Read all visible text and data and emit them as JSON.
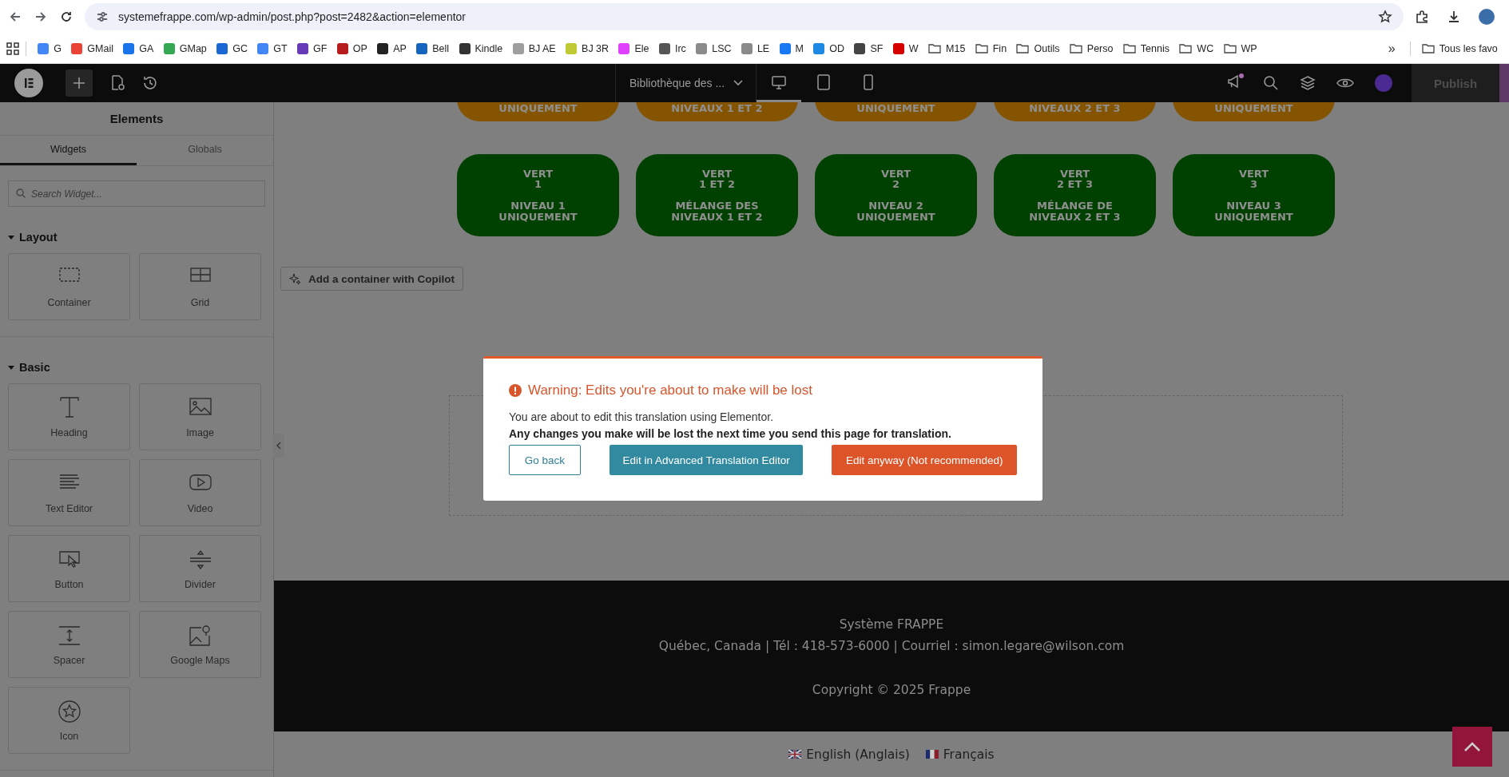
{
  "browser": {
    "address": "systemefrappe.com/wp-admin/post.php?post=2482&action=elementor",
    "bookmarks": [
      {
        "label": "G",
        "kind": "site",
        "color": "#4285f4"
      },
      {
        "label": "GMail",
        "kind": "site",
        "color": "#ea4335"
      },
      {
        "label": "GA",
        "kind": "site",
        "color": "#1a73e8"
      },
      {
        "label": "GMap",
        "kind": "site",
        "color": "#34a853"
      },
      {
        "label": "GC",
        "kind": "site",
        "color": "#1967d2"
      },
      {
        "label": "GT",
        "kind": "site",
        "color": "#4285f4"
      },
      {
        "label": "GF",
        "kind": "site",
        "color": "#673ab7"
      },
      {
        "label": "OP",
        "kind": "site",
        "color": "#b71c1c"
      },
      {
        "label": "AP",
        "kind": "site",
        "color": "#222222"
      },
      {
        "label": "Bell",
        "kind": "site",
        "color": "#1565c0"
      },
      {
        "label": "Kindle",
        "kind": "site",
        "color": "#333333"
      },
      {
        "label": "BJ AE",
        "kind": "site",
        "color": "#9e9e9e"
      },
      {
        "label": "BJ 3R",
        "kind": "site",
        "color": "#c0ca33"
      },
      {
        "label": "Ele",
        "kind": "site",
        "color": "#e040fb"
      },
      {
        "label": "Irc",
        "kind": "site",
        "color": "#555555"
      },
      {
        "label": "LSC",
        "kind": "site",
        "color": "#8a8a8a"
      },
      {
        "label": "LE",
        "kind": "site",
        "color": "#8a8a8a"
      },
      {
        "label": "M",
        "kind": "site",
        "color": "#1877f2"
      },
      {
        "label": "OD",
        "kind": "site",
        "color": "#1e88e5"
      },
      {
        "label": "SF",
        "kind": "site",
        "color": "#444444"
      },
      {
        "label": "W",
        "kind": "site",
        "color": "#d50000"
      },
      {
        "label": "M15",
        "kind": "folder"
      },
      {
        "label": "Fin",
        "kind": "folder"
      },
      {
        "label": "Outils",
        "kind": "folder"
      },
      {
        "label": "Perso",
        "kind": "folder"
      },
      {
        "label": "Tennis",
        "kind": "folder"
      },
      {
        "label": "WC",
        "kind": "folder"
      },
      {
        "label": "WP",
        "kind": "folder"
      }
    ],
    "more": "»",
    "all_bookmarks": "Tous les favo"
  },
  "editor_bar": {
    "library": "Bibliothèque des ...",
    "devices": [
      {
        "kind": "desktop",
        "selected": true
      },
      {
        "kind": "tablet",
        "selected": false
      },
      {
        "kind": "mobile",
        "selected": false
      }
    ],
    "publish": "Publish"
  },
  "panel": {
    "title": "Elements",
    "tabs": [
      {
        "label": "Widgets",
        "selected": true
      },
      {
        "label": "Globals",
        "selected": false
      }
    ],
    "search": {
      "placeholder": "Search Widget..."
    },
    "sections": [
      {
        "title": "Layout",
        "expanded": true,
        "widgets": [
          {
            "label": "Container",
            "kind": "container"
          },
          {
            "label": "Grid",
            "kind": "grid"
          }
        ]
      },
      {
        "title": "Basic",
        "expanded": true,
        "widgets": [
          {
            "label": "Heading",
            "kind": "heading"
          },
          {
            "label": "Image",
            "kind": "image"
          },
          {
            "label": "Text Editor",
            "kind": "text"
          },
          {
            "label": "Video",
            "kind": "video"
          },
          {
            "label": "Button",
            "kind": "button"
          },
          {
            "label": "Divider",
            "kind": "divider"
          },
          {
            "label": "Spacer",
            "kind": "spacer"
          },
          {
            "label": "Google Maps",
            "kind": "map"
          },
          {
            "label": "Icon",
            "kind": "icon"
          }
        ]
      }
    ]
  },
  "canvas": {
    "top_buttons": [
      {
        "description": "UNIQUEMENT",
        "color": "#845400"
      },
      {
        "description": "NIVEAUX 1 ET 2",
        "color": "#845400"
      },
      {
        "description": "UNIQUEMENT",
        "color": "#845400"
      },
      {
        "description": "NIVEAUX 2 ET 3",
        "color": "#845400"
      },
      {
        "description": "UNIQUEMENT",
        "color": "#845400"
      }
    ],
    "level_buttons": [
      {
        "label": "VERT\n1",
        "description": "NIVEAU 1\nUNIQUEMENT",
        "color": "#004000"
      },
      {
        "label": "VERT\n1 ET 2",
        "description": "MÉLANGE DES\nNIVEAUX 1 ET 2",
        "color": "#004000"
      },
      {
        "label": "VERT\n2",
        "description": "NIVEAU 2\nUNIQUEMENT",
        "color": "#004000"
      },
      {
        "label": "VERT\n2 ET 3",
        "description": "MÉLANGE DE\nNIVEAUX 2 ET 3",
        "color": "#004000"
      },
      {
        "label": "VERT\n3",
        "description": "NIVEAU 3\nUNIQUEMENT",
        "color": "#004000"
      }
    ],
    "copilot_button": "Add a container with Copilot",
    "footer": [
      "Système FRAPPE",
      "Québec, Canada | Tél : 418-573-6000 | Courriel : simon.legare@wilson.com",
      "Copyright © 2025 Frappe"
    ],
    "languages": [
      {
        "label": "English (Anglais)",
        "kind": "uk"
      },
      {
        "label": "Français",
        "kind": "fr"
      }
    ]
  },
  "dialog": {
    "title": "Warning: Edits you're about to make will be lost",
    "text": "You are about to edit this translation using Elementor.",
    "bold_text": "Any changes you make will be lost the next time you send this page for translation.",
    "buttons": [
      {
        "label": "Go back",
        "kind": "outline"
      },
      {
        "label": "Edit in Advanced Translation Editor",
        "kind": "primary"
      },
      {
        "label": "Edit anyway (Not recommended)",
        "kind": "danger"
      }
    ]
  }
}
